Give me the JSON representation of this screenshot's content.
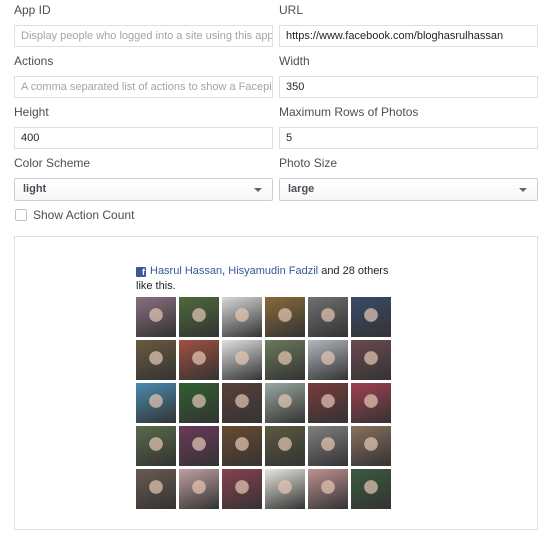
{
  "form": {
    "app_id": {
      "label": "App ID",
      "placeholder": "Display people who logged into a site using this app",
      "value": ""
    },
    "url": {
      "label": "URL",
      "value": "https://www.facebook.com/bloghasrulhassan"
    },
    "actions": {
      "label": "Actions",
      "placeholder": "A comma separated list of actions to show a Facepile fo",
      "value": ""
    },
    "width": {
      "label": "Width",
      "value": "350"
    },
    "height": {
      "label": "Height",
      "value": "400"
    },
    "max_rows": {
      "label": "Maximum Rows of Photos",
      "value": "5"
    },
    "color_scheme": {
      "label": "Color Scheme",
      "value": "light"
    },
    "photo_size": {
      "label": "Photo Size",
      "value": "large"
    },
    "show_action_count": {
      "label": "Show Action Count",
      "checked": false
    }
  },
  "preview": {
    "fb_icon": "facebook-icon",
    "friend1": "Hasrul Hassan",
    "separator": ", ",
    "friend2": "Hisyamudin Fadzil",
    "rest": " and 28 others like this.",
    "photo_colors": [
      "#8a6f80",
      "#4e6a3a",
      "#d8d8d8",
      "#8a6a3a",
      "#707070",
      "#3a4a6a",
      "#6a5a40",
      "#a05040",
      "#e0e0e0",
      "#6a7a5a",
      "#b0b8c0",
      "#6a4a50",
      "#4a8ab0",
      "#306030",
      "#5a4038",
      "#9aa8a0",
      "#7a3a3a",
      "#a04050",
      "#5a6a4a",
      "#6a3a5a",
      "#6a4a30",
      "#5a5a40",
      "#808080",
      "#8a7060",
      "#6a5a50",
      "#c0a0a0",
      "#8a4050",
      "#e8e8e0",
      "#c09090",
      "#3a5a40"
    ]
  }
}
